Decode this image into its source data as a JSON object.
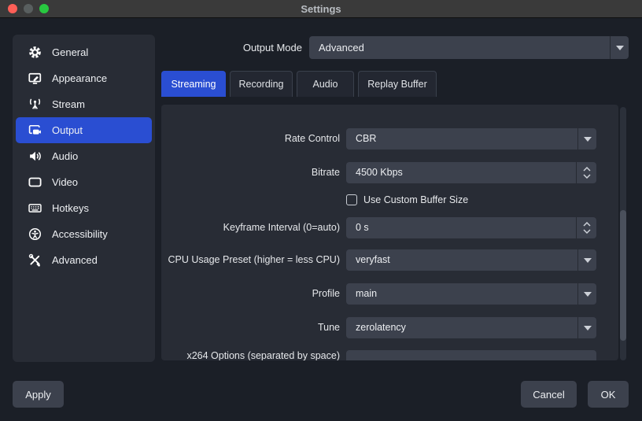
{
  "window": {
    "title": "Settings"
  },
  "titlebar": {
    "icons": [
      "close-icon",
      "minimize-icon-disabled",
      "zoom-icon"
    ]
  },
  "sidebar": {
    "selected_index": 3,
    "items": [
      {
        "icon": "gear-icon",
        "label": "General"
      },
      {
        "icon": "appearance-icon",
        "label": "Appearance"
      },
      {
        "icon": "broadcast-icon",
        "label": "Stream"
      },
      {
        "icon": "output-icon",
        "label": "Output"
      },
      {
        "icon": "speaker-icon",
        "label": "Audio"
      },
      {
        "icon": "display-icon",
        "label": "Video"
      },
      {
        "icon": "keyboard-icon",
        "label": "Hotkeys"
      },
      {
        "icon": "accessibility-icon",
        "label": "Accessibility"
      },
      {
        "icon": "tools-icon",
        "label": "Advanced"
      }
    ]
  },
  "output_mode": {
    "label": "Output Mode",
    "value": "Advanced"
  },
  "tabs": [
    {
      "label": "Streaming",
      "selected": true
    },
    {
      "label": "Recording",
      "selected": false
    },
    {
      "label": "Audio",
      "selected": false
    },
    {
      "label": "Replay Buffer",
      "selected": false
    }
  ],
  "form": {
    "rate_control": {
      "label": "Rate Control",
      "value": "CBR",
      "control": "dropdown"
    },
    "bitrate": {
      "label": "Bitrate",
      "value": "4500 Kbps",
      "control": "spinbox"
    },
    "custom_buffer": {
      "label": "Use Custom Buffer Size",
      "checked": false,
      "control": "checkbox"
    },
    "keyframe_interval": {
      "label": "Keyframe Interval (0=auto)",
      "value": "0 s",
      "control": "spinbox"
    },
    "cpu_preset": {
      "label": "CPU Usage Preset (higher = less CPU)",
      "value": "veryfast",
      "control": "dropdown"
    },
    "profile": {
      "label": "Profile",
      "value": "main",
      "control": "dropdown"
    },
    "tune": {
      "label": "Tune",
      "value": "zerolatency",
      "control": "dropdown"
    },
    "x264_options": {
      "label": "x264 Options (separated by space)",
      "value": "",
      "control": "text"
    }
  },
  "buttons": {
    "apply": "Apply",
    "cancel": "Cancel",
    "ok": "OK"
  },
  "colors": {
    "accent": "#2a4ed2",
    "window_bg": "#1b1f27",
    "panel_bg": "#282c35",
    "field_bg": "#3c414d",
    "titlebar_bg": "#3a3a3a",
    "traffic_red": "#ff5f57",
    "traffic_gray": "#595f5f",
    "traffic_green": "#28c840"
  }
}
